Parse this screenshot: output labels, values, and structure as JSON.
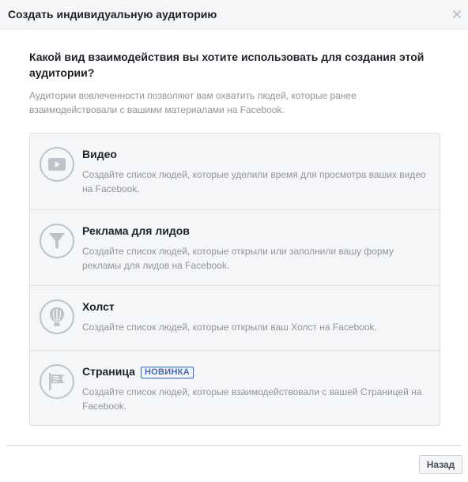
{
  "dialog": {
    "title": "Создать индивидуальную аудиторию",
    "close_symbol": "×"
  },
  "main": {
    "question": "Какой вид взаимодействия вы хотите использовать для создания этой аудитории?",
    "subtext": "Аудитории вовлеченности позволяют вам охватить людей, которые ранее взаимодействовали с вашими материалами на Facebook."
  },
  "options": [
    {
      "title": "Видео",
      "description": "Создайте список людей, которые уделили время для просмотра ваших видео на Facebook.",
      "icon": "video-icon"
    },
    {
      "title": "Реклама для лидов",
      "description": "Создайте список людей, которые открыли или заполнили вашу форму рекламы для лидов на Facebook.",
      "icon": "funnel-icon"
    },
    {
      "title": "Холст",
      "description": "Создайте список людей, которые открыли ваш Холст на Facebook.",
      "icon": "canvas-icon"
    },
    {
      "title": "Страница",
      "badge": "НОВИНКА",
      "description": "Создайте список людей, которые взаимодействовали с вашей Страницей на Facebook.",
      "icon": "page-flag-icon"
    }
  ],
  "footer": {
    "back_label": "Назад"
  },
  "colors": {
    "header_bg": "#f5f6f7",
    "icon_gray": "#bec2c9",
    "badge_blue": "#4267b2",
    "secondary_text": "#90949c"
  }
}
